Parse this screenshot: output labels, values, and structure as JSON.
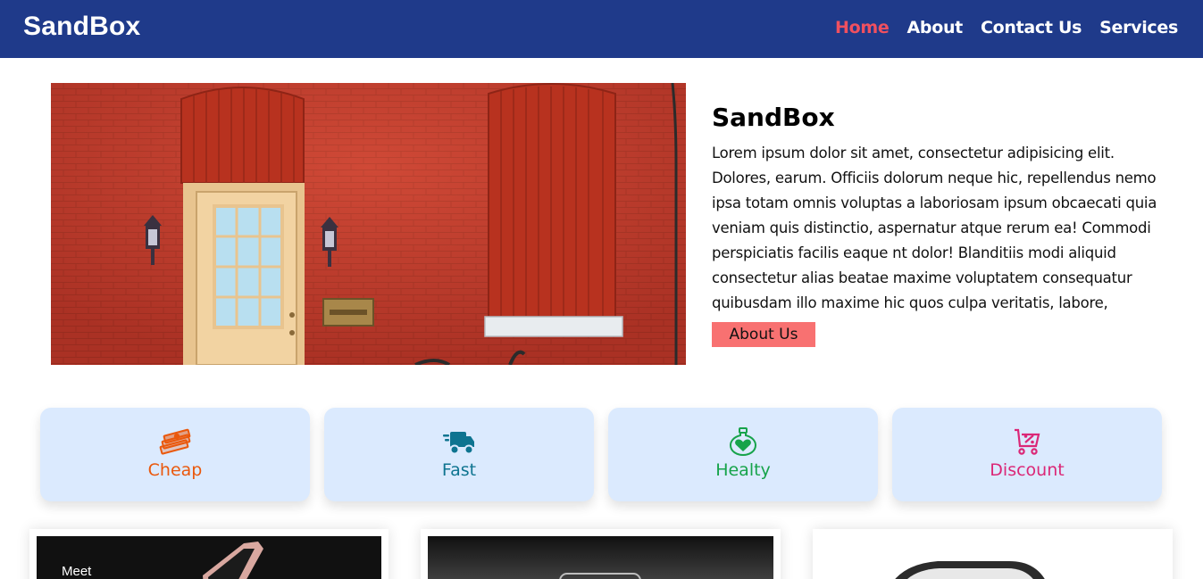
{
  "navbar": {
    "brand": "SandBox",
    "links": [
      {
        "label": "Home",
        "active": true
      },
      {
        "label": "About",
        "active": false
      },
      {
        "label": "Contact Us",
        "active": false
      },
      {
        "label": "Services",
        "active": false
      }
    ]
  },
  "hero": {
    "title": "SandBox",
    "description": "Lorem ipsum dolor sit amet, consectetur adipisicing elit. Dolores, earum. Officiis dolorum neque hic, repellendus nemo ipsa totam omnis voluptas a laboriosam ipsum obcaecati quia veniam quis distinctio, aspernatur atque rerum ea! Commodi perspiciatis facilis eaque nt dolor! Blanditiis modi aliquid consectetur alias beatae maxime voluptatem consequatur quibusdam illo maxime hic quos culpa veritatis, labore,",
    "button_label": "About Us"
  },
  "features": [
    {
      "label": "Cheap",
      "icon": "money-icon",
      "color": "#ea580c"
    },
    {
      "label": "Fast",
      "icon": "truck-icon",
      "color": "#0e7490"
    },
    {
      "label": "Healty",
      "icon": "heart-flask-icon",
      "color": "#16a34a"
    },
    {
      "label": "Discount",
      "icon": "cart-discount-icon",
      "color": "#db2777"
    }
  ],
  "products": {
    "first_card_caption": "Meet"
  },
  "colors": {
    "navbar_bg": "#1f3a8a",
    "active_link": "#f0505f",
    "button_bg": "#f87171",
    "card_bg": "#dbeafe"
  }
}
